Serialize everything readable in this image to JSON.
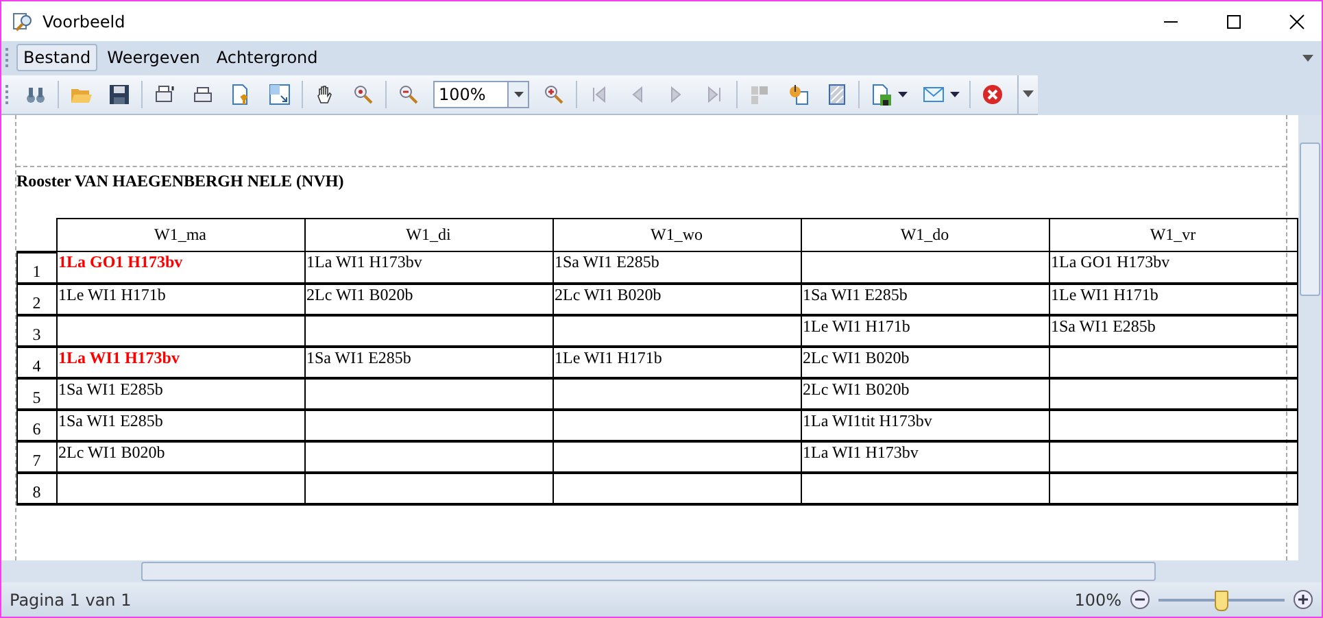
{
  "window": {
    "title": "Voorbeeld"
  },
  "menu": [
    {
      "label": "Bestand",
      "selected": true
    },
    {
      "label": "Weergeven",
      "selected": false
    },
    {
      "label": "Achtergrond",
      "selected": false
    }
  ],
  "toolbar": {
    "zoom_value": "100%"
  },
  "report": {
    "title": "Rooster VAN HAEGENBERGH NELE (NVH)",
    "columns": [
      "W1_ma",
      "W1_di",
      "W1_wo",
      "W1_do",
      "W1_vr"
    ],
    "rows": [
      {
        "number": "1",
        "cells": [
          {
            "text": "1La GO1 H173bv",
            "highlighted": true
          },
          {
            "text": "1La WI1 H173bv",
            "highlighted": false
          },
          {
            "text": "1Sa WI1 E285b",
            "highlighted": false
          },
          null,
          {
            "text": "1La GO1 H173bv",
            "highlighted": false
          }
        ]
      },
      {
        "number": "2",
        "cells": [
          {
            "text": "1Le WI1 H171b",
            "highlighted": false
          },
          {
            "text": "2Lc WI1 B020b",
            "highlighted": false
          },
          {
            "text": "2Lc WI1 B020b",
            "highlighted": false
          },
          {
            "text": "1Sa WI1 E285b",
            "highlighted": false
          },
          {
            "text": "1Le WI1 H171b",
            "highlighted": false
          }
        ]
      },
      {
        "number": "3",
        "cells": [
          null,
          null,
          null,
          {
            "text": "1Le WI1 H171b",
            "highlighted": false
          },
          {
            "text": "1Sa WI1 E285b",
            "highlighted": false
          }
        ]
      },
      {
        "number": "4",
        "cells": [
          {
            "text": "1La WI1 H173bv",
            "highlighted": true
          },
          {
            "text": "1Sa WI1 E285b",
            "highlighted": false
          },
          {
            "text": "1Le WI1 H171b",
            "highlighted": false
          },
          {
            "text": "2Lc WI1 B020b",
            "highlighted": false
          },
          null
        ]
      },
      {
        "number": "5",
        "cells": [
          {
            "text": "1Sa WI1 E285b",
            "highlighted": false
          },
          null,
          null,
          {
            "text": "2Lc WI1 B020b",
            "highlighted": false
          },
          null
        ]
      },
      {
        "number": "6",
        "cells": [
          {
            "text": "1Sa WI1 E285b",
            "highlighted": false
          },
          null,
          null,
          {
            "text": "1La WI1tit H173bv",
            "highlighted": false
          },
          null
        ]
      },
      {
        "number": "7",
        "cells": [
          {
            "text": "2Lc WI1 B020b",
            "highlighted": false
          },
          null,
          null,
          {
            "text": "1La WI1 H173bv",
            "highlighted": false
          },
          null
        ]
      },
      {
        "number": "8",
        "cells": [
          null,
          null,
          null,
          null,
          null
        ]
      }
    ]
  },
  "status_bar": {
    "page": "Pagina 1 van 1",
    "zoom": "100%",
    "zoom_slider": {
      "level": 0.5
    }
  }
}
